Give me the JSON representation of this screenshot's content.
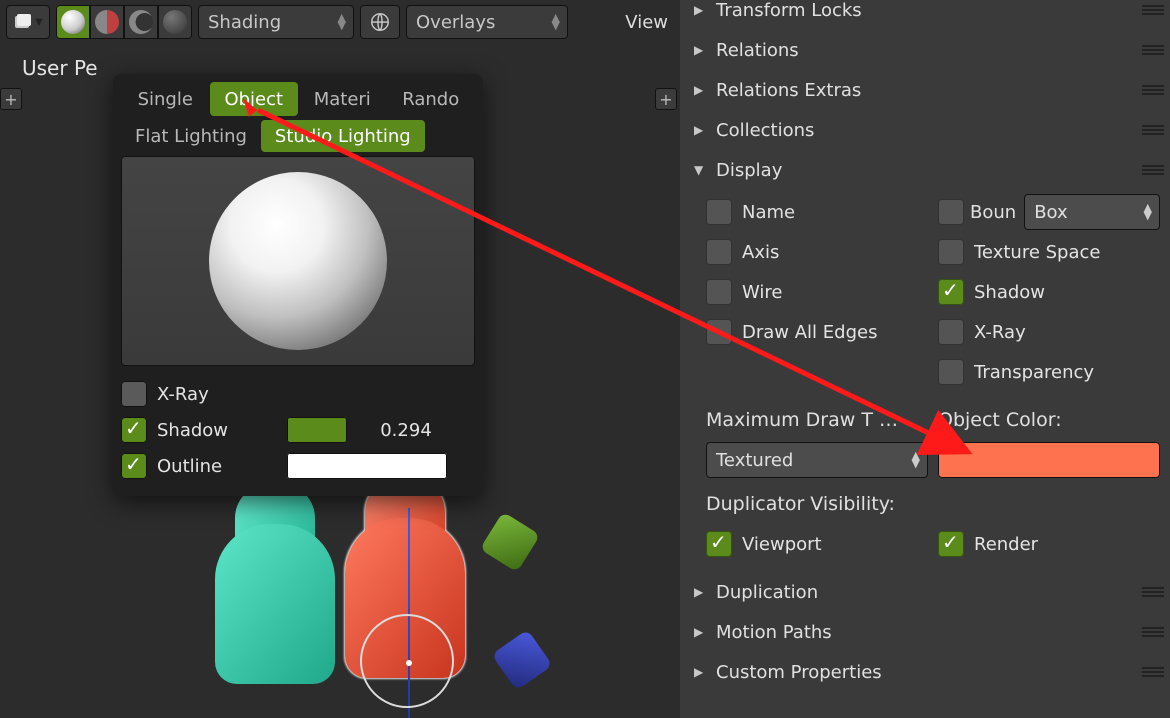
{
  "header": {
    "shading_label": "Shading",
    "overlays_label": "Overlays",
    "view_label": "View"
  },
  "viewport": {
    "user_persp": "User Pe"
  },
  "shading_popover": {
    "tabs": [
      "Single",
      "Object",
      "Materi",
      "Rando"
    ],
    "lighting_tabs": [
      "Flat Lighting",
      "Studio Lighting"
    ],
    "xray_label": "X-Ray",
    "shadow_label": "Shadow",
    "shadow_value": "0.294",
    "shadow_color": "#5b8c1b",
    "outline_label": "Outline",
    "outline_color": "#ffffff"
  },
  "properties": {
    "sections": {
      "transform_locks": "Transform Locks",
      "relations": "Relations",
      "relations_extras": "Relations Extras",
      "collections": "Collections",
      "display": "Display",
      "duplication": "Duplication",
      "motion_paths": "Motion Paths",
      "custom_properties": "Custom Properties"
    },
    "display": {
      "name": "Name",
      "boun": "Boun",
      "bounds_type": "Box",
      "axis": "Axis",
      "texture_space": "Texture Space",
      "wire": "Wire",
      "shadow": "Shadow",
      "draw_all_edges": "Draw All Edges",
      "xray": "X-Ray",
      "transparency": "Transparency",
      "max_draw_label": "Maximum Draw T …",
      "max_draw_value": "Textured",
      "object_color_label": "Object Color:",
      "object_color": "#ff724f",
      "dup_vis_label": "Duplicator Visibility:",
      "viewport": "Viewport",
      "render": "Render"
    }
  }
}
